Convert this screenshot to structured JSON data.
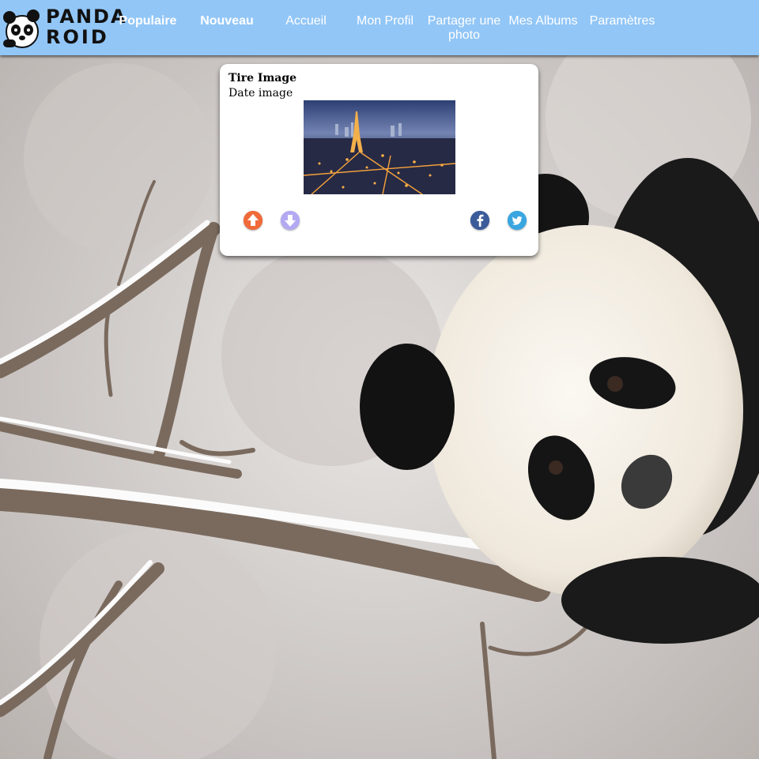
{
  "logo": {
    "line1": "PANDA",
    "line2": "ROID"
  },
  "nav": [
    {
      "label": "Populaire",
      "bold": true
    },
    {
      "label": "Nouveau",
      "bold": true
    },
    {
      "label": "Accueil",
      "bold": false
    },
    {
      "label": "Mon Profil",
      "bold": false
    },
    {
      "label": "Partager une photo",
      "bold": false
    },
    {
      "label": "Mes Albums",
      "bold": false
    },
    {
      "label": "Paramètres",
      "bold": false
    }
  ],
  "card": {
    "title": "Tire Image",
    "date": "Date image"
  },
  "icons": {
    "upvote": "arrow-up-icon",
    "downvote": "arrow-down-icon",
    "facebook": "facebook-icon",
    "twitter": "twitter-icon"
  },
  "colors": {
    "header": "#92c6f7",
    "upvote": "#f06a3a",
    "downvote": "#b3a9f2",
    "facebook": "#3b5b9a",
    "twitter": "#3aa6e0"
  }
}
